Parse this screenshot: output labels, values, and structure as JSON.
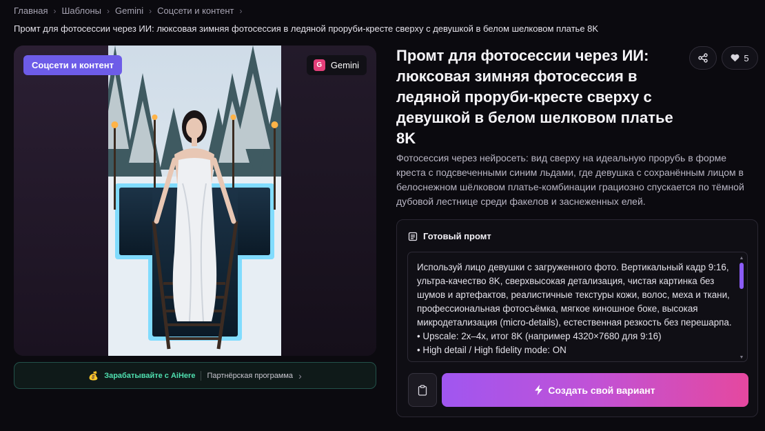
{
  "breadcrumb": {
    "items": [
      "Главная",
      "Шаблоны",
      "Gemini",
      "Соцсети и контент"
    ]
  },
  "subtitle": "Промт для фотосессии через ИИ: люксовая зимняя фотосессия в ледяной проруби-кресте сверху с девушкой в белом шелковом платье 8K",
  "image_card": {
    "category_badge": "Соцсети и контент",
    "model_badge": "Gemini",
    "model_badge_icon": "G",
    "accent_color": "#6d5ce8"
  },
  "partner_bar": {
    "icon": "money-bag-icon",
    "earn_label": "Зарабатывайте с AiHere",
    "program_label": "Партнёрская программа"
  },
  "title": "Промт для фотосессии через ИИ: люксовая зимняя фотосессия в ледяной проруби-кресте сверху с девушкой в белом шелковом платье 8K",
  "actions": {
    "like_count": "5"
  },
  "description": "Фотосессия через нейросеть: вид сверху на идеальную прорубь в форме креста с подсвеченными синим льдами, где девушка с сохранённым лицом в белоснежном шёлковом платье-комбинации грациозно спускается по тёмной дубовой лестнице среди факелов и заснеженных елей.",
  "prompt_panel": {
    "header": "Готовый промт",
    "text": "Используй лицо девушки с загруженного фото. Вертикальный кадр 9:16, ультра-качество 8K, сверхвысокая детализация, чистая картинка без шумов и артефактов, реалистичные текстуры кожи, волос, меха и ткани, профессиональная фотосъёмка, мягкое киношное боке, высокая микродетализация (micro-details), естественная резкость без перешарпа.",
    "bullets": [
      "• Upscale: 2x–4x, итог 8K (например 4320×7680 для 9:16)",
      "• High detail / High fidelity mode: ON"
    ],
    "create_button": "Создать свой вариант"
  }
}
